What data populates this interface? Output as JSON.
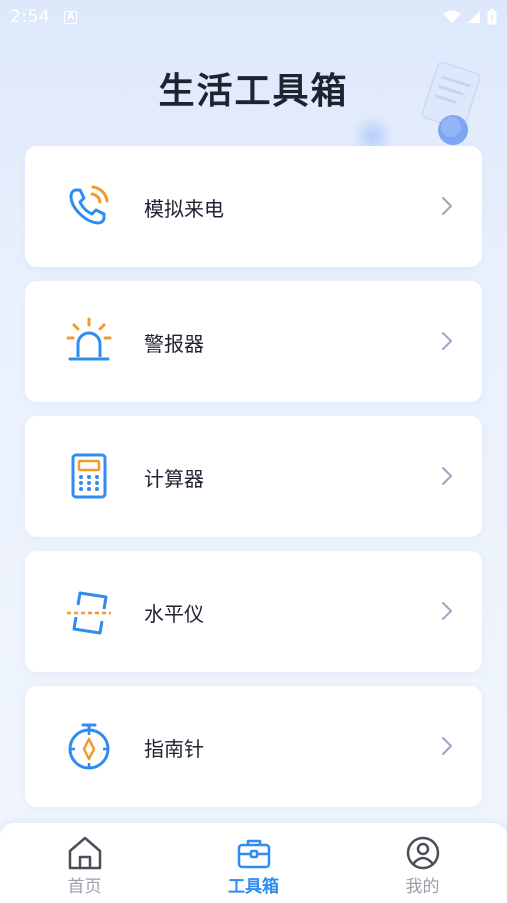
{
  "status_bar": {
    "time": "2:54",
    "notification_letter": "A"
  },
  "page": {
    "title": "生活工具箱"
  },
  "tools": [
    {
      "label": "模拟来电",
      "icon": "phone-call-icon"
    },
    {
      "label": "警报器",
      "icon": "alarm-light-icon"
    },
    {
      "label": "计算器",
      "icon": "calculator-icon"
    },
    {
      "label": "水平仪",
      "icon": "level-icon"
    },
    {
      "label": "指南针",
      "icon": "compass-icon"
    }
  ],
  "tab_bar": {
    "tabs": [
      {
        "label": "首页",
        "icon": "home-icon",
        "active": false
      },
      {
        "label": "工具箱",
        "icon": "toolbox-icon",
        "active": true
      },
      {
        "label": "我的",
        "icon": "profile-icon",
        "active": false
      }
    ]
  },
  "colors": {
    "accent_blue": "#2f8cf0",
    "accent_orange": "#f39a2b",
    "inactive_gray": "#9aa0aa",
    "icon_gray": "#4a4f5a",
    "chevron_gray": "#9ea6c4"
  }
}
